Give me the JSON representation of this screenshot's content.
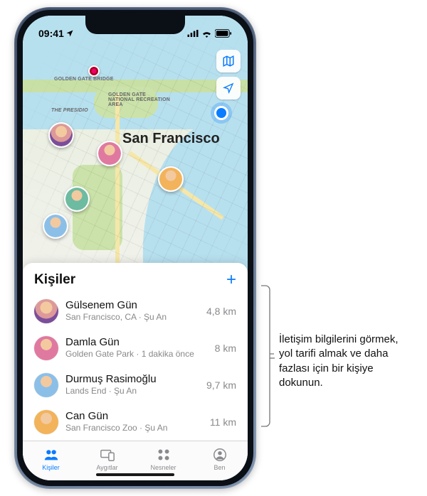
{
  "status": {
    "time": "09:41"
  },
  "map": {
    "city_label": "San Francisco",
    "poi_golden_gate_bridge": "GOLDEN GATE BRIDGE",
    "poi_recreation": "Golden Gate National Recreation Area",
    "poi_presidio": "The Presidio"
  },
  "sheet": {
    "title": "Kişiler",
    "people": [
      {
        "name": "Gülsenem Gün",
        "sub": "San Francisco, CA · Şu An",
        "distance": "4,8 km"
      },
      {
        "name": "Damla Gün",
        "sub": "Golden Gate Park · 1 dakika önce",
        "distance": "8 km"
      },
      {
        "name": "Durmuş Rasimoğlu",
        "sub": "Lands End · Şu An",
        "distance": "9,7 km"
      },
      {
        "name": "Can Gün",
        "sub": "San Francisco Zoo · Şu An",
        "distance": "11 km"
      }
    ]
  },
  "tabs": {
    "people": "Kişiler",
    "devices": "Aygıtlar",
    "items": "Nesneler",
    "me": "Ben"
  },
  "callout": "İletişim bilgilerini görmek, yol tarifi almak ve daha fazlası için bir kişiye dokunun."
}
